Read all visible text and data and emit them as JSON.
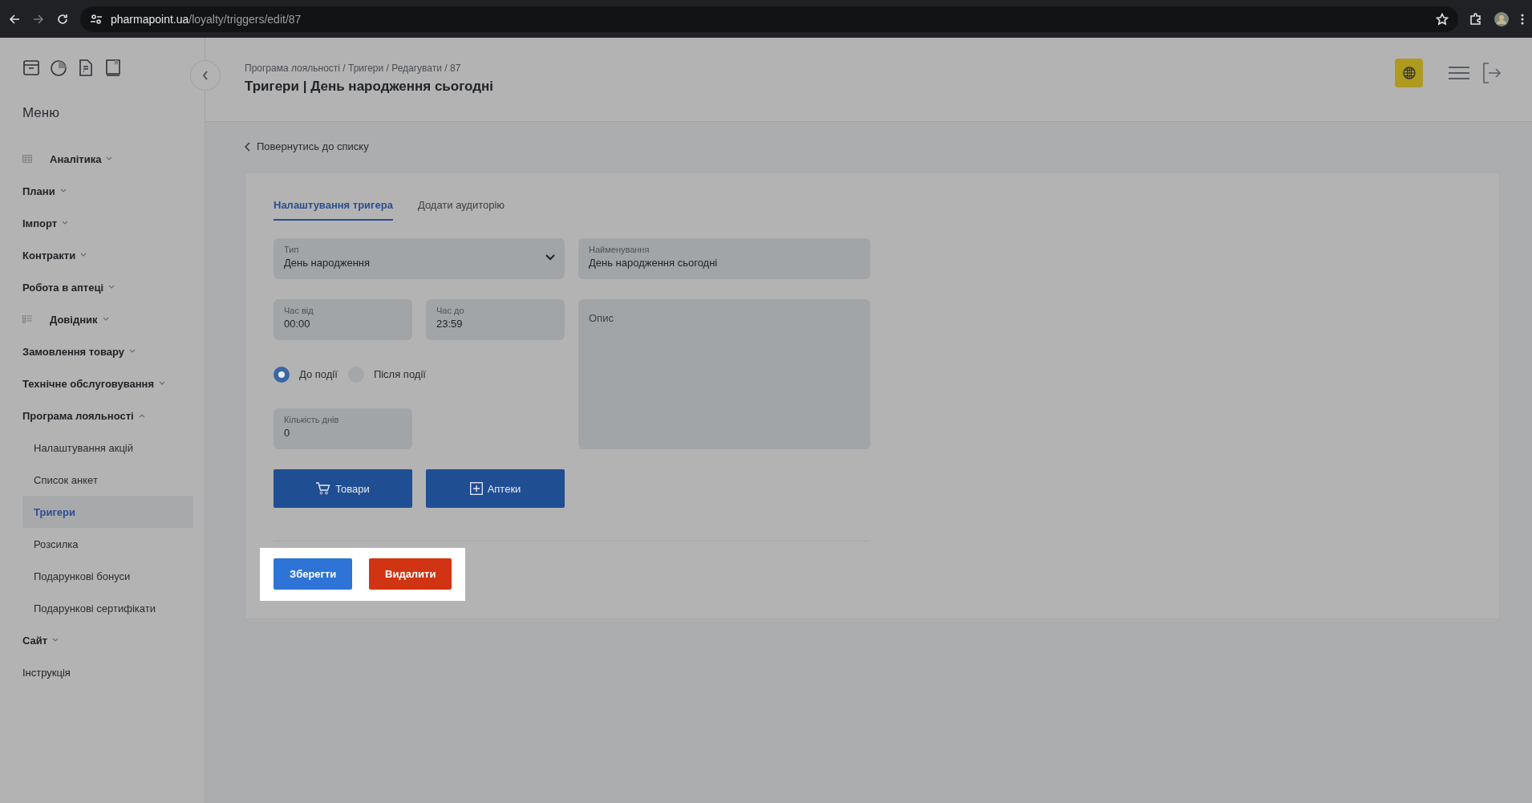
{
  "browser": {
    "url_host": "pharmapoint.ua",
    "url_path": "/loyalty/triggers/edit/87"
  },
  "sidebar": {
    "title": "Меню",
    "items": [
      {
        "label": "Аналітика",
        "kind": "table-section",
        "expanded": false
      },
      {
        "label": "Плани",
        "kind": "section",
        "expanded": false
      },
      {
        "label": "Імпорт",
        "kind": "section",
        "expanded": false
      },
      {
        "label": "Контракти",
        "kind": "section",
        "expanded": false
      },
      {
        "label": "Робота в аптеці",
        "kind": "section",
        "expanded": false
      },
      {
        "label": "Довідник",
        "kind": "list-section",
        "expanded": false
      },
      {
        "label": "Замовлення товару",
        "kind": "section",
        "expanded": false
      },
      {
        "label": "Технічне обслуговування",
        "kind": "section",
        "expanded": false
      },
      {
        "label": "Програма лояльності",
        "kind": "section",
        "expanded": true,
        "children": [
          {
            "label": "Налаштування акцій",
            "selected": false
          },
          {
            "label": "Список анкет",
            "selected": false
          },
          {
            "label": "Тригери",
            "selected": true
          },
          {
            "label": "Розсилка",
            "selected": false
          },
          {
            "label": "Подарункові бонуси",
            "selected": false
          },
          {
            "label": "Подарункові сертифікати",
            "selected": false
          }
        ]
      },
      {
        "label": "Сайт",
        "kind": "section",
        "expanded": false
      },
      {
        "label": "Інструкція",
        "kind": "link"
      }
    ]
  },
  "header": {
    "breadcrumb": "Програма лояльності / Тригери / Редагувати / 87",
    "title": "Тригери | День народження сьогодні"
  },
  "back_link": "Повернутись до списку",
  "tabs": [
    {
      "label": "Налаштування тригера",
      "selected": true
    },
    {
      "label": "Додати аудиторію",
      "selected": false
    }
  ],
  "form": {
    "type": {
      "label": "Тип",
      "value": "День народження"
    },
    "name": {
      "label": "Найменування",
      "value": "День народження сьогодні"
    },
    "time_from": {
      "label": "Час від",
      "value": "00:00"
    },
    "time_to": {
      "label": "Час до",
      "value": "23:59"
    },
    "description": {
      "placeholder": "Опис"
    },
    "radios": [
      {
        "label": "До події",
        "selected": true
      },
      {
        "label": "Після події",
        "selected": false
      }
    ],
    "days": {
      "label": "Кількість днів",
      "value": "0"
    },
    "buttons": [
      {
        "label": "Товари",
        "kind": "cart"
      },
      {
        "label": "Аптеки",
        "kind": "plus"
      }
    ]
  },
  "actions": {
    "highlighted": true,
    "buttons": [
      {
        "label": "Зберегти",
        "kind": "primary"
      },
      {
        "label": "Видалити",
        "kind": "danger"
      }
    ]
  }
}
